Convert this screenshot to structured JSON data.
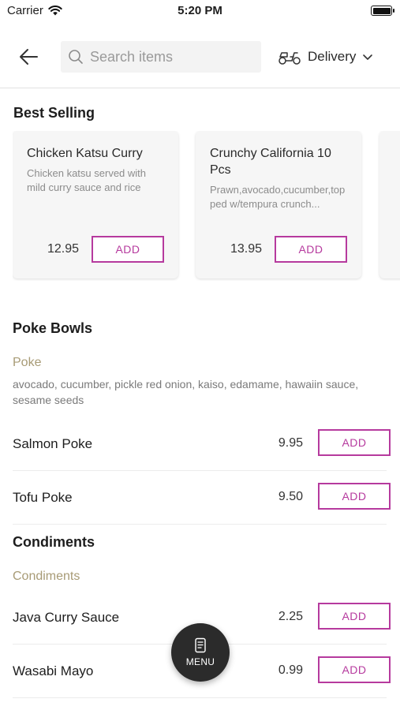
{
  "status_bar": {
    "carrier": "Carrier",
    "time": "5:20 PM"
  },
  "header": {
    "search_placeholder": "Search items",
    "delivery_label": "Delivery"
  },
  "best_selling": {
    "title": "Best Selling",
    "cards": [
      {
        "name": "Chicken Katsu Curry",
        "description": "Chicken katsu served with mild curry sauce and rice",
        "price": "12.95",
        "add_label": "ADD"
      },
      {
        "name": "Crunchy California 10 Pcs",
        "description": "Prawn,avocado,cucumber,topped w/tempura crunch...",
        "price": "13.95",
        "add_label": "ADD"
      }
    ]
  },
  "poke_bowls": {
    "title": "Poke Bowls",
    "subcategory": "Poke",
    "subcategory_desc": "avocado, cucumber, pickle red onion, kaiso, edamame, hawaiin sauce, sesame seeds",
    "items": [
      {
        "name": "Salmon Poke",
        "price": "9.95",
        "add_label": "ADD"
      },
      {
        "name": "Tofu Poke",
        "price": "9.50",
        "add_label": "ADD"
      }
    ]
  },
  "condiments": {
    "title": "Condiments",
    "subcategory": "Condiments",
    "items": [
      {
        "name": "Java Curry Sauce",
        "price": "2.25",
        "add_label": "ADD"
      },
      {
        "name": "Wasabi Mayo",
        "price": "0.99",
        "add_label": "ADD"
      }
    ]
  },
  "menu_fab": {
    "label": "MENU"
  },
  "colors": {
    "accent": "#b63a9e",
    "subcategory": "#a89b76",
    "fab": "#2b2b2b"
  }
}
